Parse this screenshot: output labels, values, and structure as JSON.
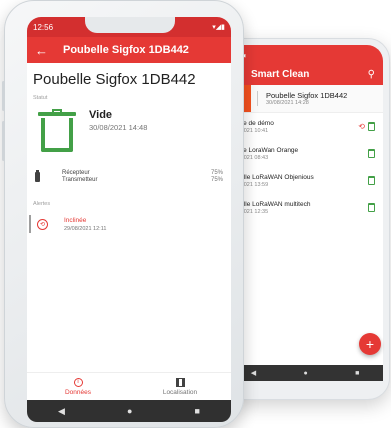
{
  "back_screen": {
    "app_title": "Smart Clean",
    "selected": {
      "tab_text": "er",
      "name": "Poubelle Sigfox 1DB442",
      "date": "30/08/2021 14:28"
    },
    "rows": [
      {
        "name": "belle de démo",
        "date": "08/2021 10:41",
        "alert": true
      },
      {
        "name": "belle LoraWan Orange",
        "date": "08/2021 08:43",
        "alert": false
      },
      {
        "name": "ubelle LoRaWAN Objenious",
        "date": "08/2021 13:59",
        "alert": false
      },
      {
        "name": "ubelle LoRaWAN multitech",
        "date": "08/2021 12:35",
        "alert": false
      }
    ],
    "fab_label": "+",
    "nav": [
      "◀",
      "●",
      "■"
    ]
  },
  "front_screen": {
    "status_bar": {
      "time": "12:56",
      "indicators": "▾◢▮"
    },
    "app_bar": {
      "title": "Poubelle Sigfox 1DB442",
      "back": "←"
    },
    "page_title": "Poubelle Sigfox 1DB442",
    "statut_label": "Statut",
    "status": {
      "value": "Vide",
      "date": "30/08/2021 14:48"
    },
    "signals": [
      {
        "label": "Récepteur",
        "value": "75%"
      },
      {
        "label": "Transmetteur",
        "value": "75%"
      }
    ],
    "alertes_label": "Alertes",
    "alert": {
      "label": "Inclinée",
      "date": "29/08/2021 12:11"
    },
    "bottom_nav": [
      {
        "label": "Données",
        "active": true
      },
      {
        "label": "Localisation",
        "active": false
      }
    ],
    "android_nav": [
      "◀",
      "●",
      "■"
    ]
  },
  "colors": {
    "accent": "#e53935",
    "status_ok": "#43a047"
  }
}
